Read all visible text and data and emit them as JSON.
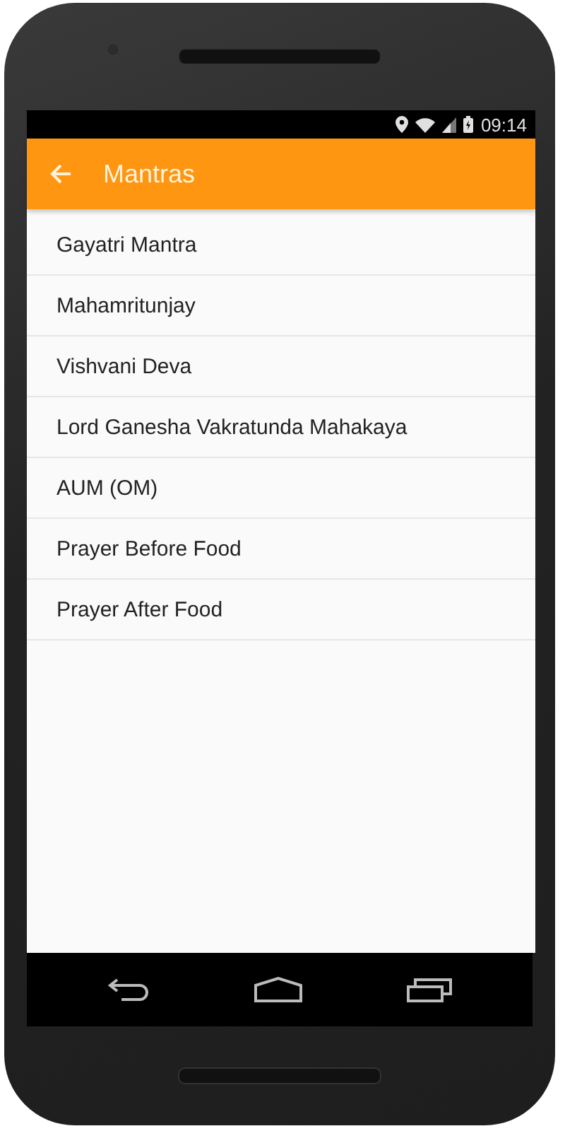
{
  "status_bar": {
    "time": "09:14"
  },
  "app_bar": {
    "title": "Mantras"
  },
  "list": {
    "items": [
      {
        "label": "Gayatri Mantra"
      },
      {
        "label": "Mahamritunjay"
      },
      {
        "label": "Vishvani Deva"
      },
      {
        "label": "Lord Ganesha Vakratunda Mahakaya"
      },
      {
        "label": "AUM (OM)"
      },
      {
        "label": "Prayer Before Food"
      },
      {
        "label": "Prayer After Food"
      }
    ]
  }
}
